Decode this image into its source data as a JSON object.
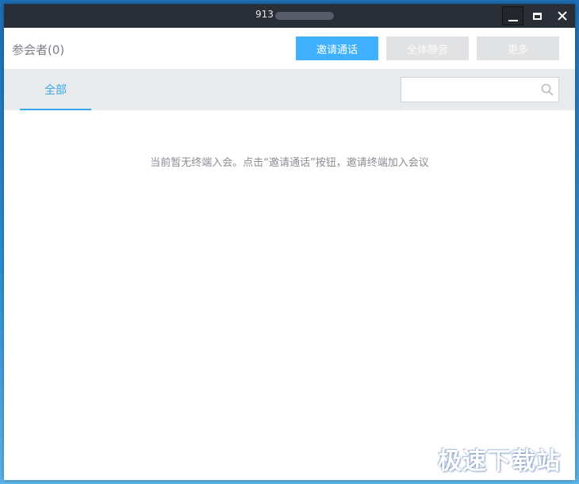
{
  "window": {
    "title": "913",
    "controls": {
      "minimize": "minimize-icon",
      "maximize": "maximize-icon",
      "close": "close-icon"
    }
  },
  "header": {
    "participants_label": "参会者(0)",
    "invite_label": "邀请通话",
    "mute_all_label": "全体静音",
    "more_label": "更多"
  },
  "tabs": [
    {
      "label": "全部",
      "active": true
    }
  ],
  "search": {
    "placeholder": "",
    "icon": "search-icon"
  },
  "content": {
    "empty_message": "当前暂无终端入会。点击“邀请通话”按钮，邀请终端加入会议"
  },
  "watermark": "极速下载站",
  "colors": {
    "titlebar": "#2a2e36",
    "accent": "#3fb1ff",
    "tab_active": "#39a6e8",
    "button_disabled": "#e1e2e4",
    "tabbar_bg": "#e8ebee"
  }
}
